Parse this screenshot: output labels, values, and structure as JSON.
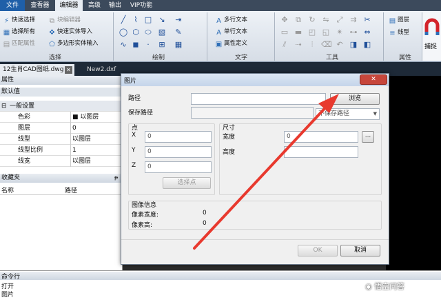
{
  "menu": {
    "items": [
      "文件",
      "查看器",
      "编辑器",
      "高级",
      "输出",
      "VIP功能"
    ],
    "active": "编辑器"
  },
  "ribbon": {
    "select_group": {
      "label": "选择",
      "quick_select": "快速选择",
      "select_all": "选择所有",
      "match_props": "匹配属性",
      "block_editor": "块编辑器",
      "quick_entity_import": "快速实体导入",
      "polygon_entity_input": "多边形实体输入"
    },
    "draw_group": {
      "label": "绘制"
    },
    "text_group": {
      "label": "文字",
      "multiline_text": "多行文本",
      "single_line_text": "单行文本",
      "attribute_def": "属性定义"
    },
    "tools_group": {
      "label": "工具"
    },
    "props_group": {
      "label": "属性",
      "layer": "图层",
      "linetype": "线型"
    },
    "capture": "捕捉"
  },
  "doc_tabs": [
    "12生肖CAD图纸.dwg",
    "New2.dxf"
  ],
  "properties": {
    "title": "属性",
    "default": "默认值",
    "section": "一般设置",
    "rows": [
      {
        "k": "色彩",
        "v": "■ 以图层"
      },
      {
        "k": "图层",
        "v": "0"
      },
      {
        "k": "线型",
        "v": "以图层"
      },
      {
        "k": "线型比例",
        "v": "1"
      },
      {
        "k": "线宽",
        "v": "以图层"
      }
    ]
  },
  "favorites": {
    "title": "收藏夹",
    "col_name": "名称",
    "col_path": "路径"
  },
  "command": {
    "title": "命令行",
    "lines": [
      "打开",
      "图片"
    ]
  },
  "dialog": {
    "title": "图片",
    "path_label": "路径",
    "path_value": "",
    "browse": "浏览",
    "save_path_label": "保存路径",
    "save_path_option": "不保存路径",
    "point_label": "点",
    "x_label": "X",
    "x_value": "0",
    "y_label": "Y",
    "y_value": "0",
    "z_label": "Z",
    "z_value": "0",
    "pick_point": "选择点",
    "size_label": "尺寸",
    "width_label": "宽度",
    "width_value": "0",
    "height_label": "高度",
    "height_value": "",
    "ellipsis": "...",
    "info_label": "图像信息",
    "px_width_label": "像素宽度:",
    "px_width_value": "0",
    "px_height_label": "像素高:",
    "px_height_value": "0",
    "ok": "OK",
    "cancel": "取消",
    "close": "✕"
  },
  "watermark": "悟空问答",
  "colors": {
    "accent_arrow": "#e8392e",
    "menubar": "#3c4a5c",
    "file_blue": "#1f5fa8"
  }
}
